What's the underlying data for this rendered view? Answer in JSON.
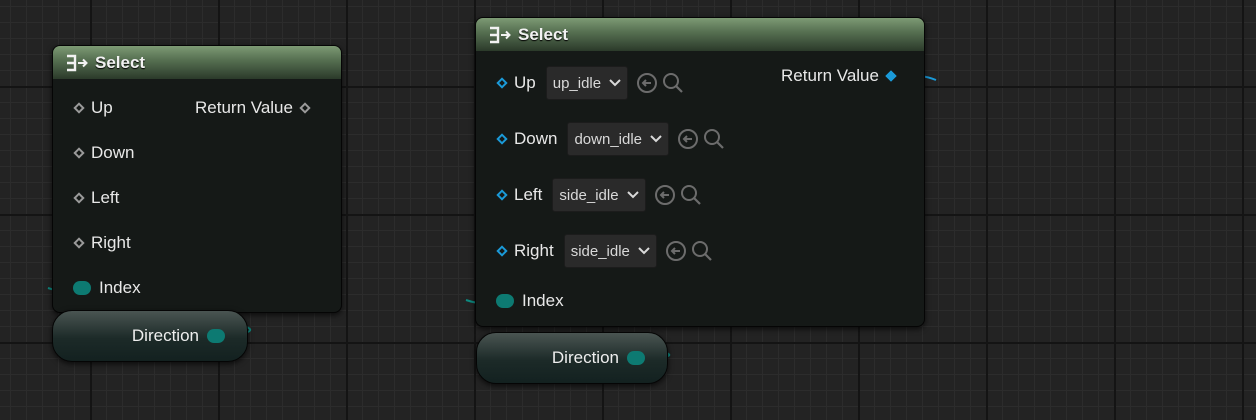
{
  "nodes": [
    {
      "title": "Select",
      "inputs": [
        {
          "label": "Up"
        },
        {
          "label": "Down"
        },
        {
          "label": "Left"
        },
        {
          "label": "Right"
        }
      ],
      "index_label": "Index",
      "output_label": "Return Value",
      "variable_label": "Direction"
    },
    {
      "title": "Select",
      "inputs": [
        {
          "label": "Up",
          "value": "up_idle"
        },
        {
          "label": "Down",
          "value": "down_idle"
        },
        {
          "label": "Left",
          "value": "side_idle"
        },
        {
          "label": "Right",
          "value": "side_idle"
        }
      ],
      "index_label": "Index",
      "output_label": "Return Value",
      "variable_label": "Direction"
    }
  ],
  "colors": {
    "header_green": "#587253",
    "object_pin_blue": "#1a9ad8",
    "enum_pin_teal": "#0d7a72",
    "wildcard_pin_gray": "#9a9a9a"
  },
  "icons": {
    "select_node": "select-function-icon",
    "use_selected": "arrow-left-circle-icon",
    "browse": "magnifier-icon"
  }
}
